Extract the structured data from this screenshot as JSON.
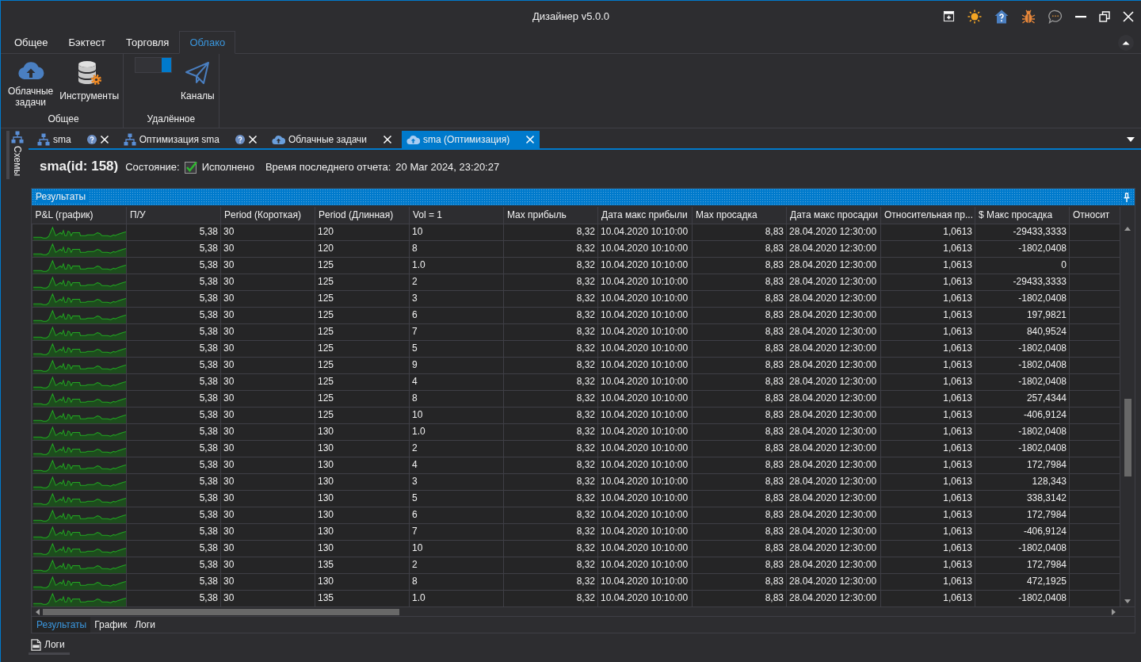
{
  "window": {
    "title": "Дизайнер v5.0.0"
  },
  "ribbon": {
    "tabs": [
      {
        "label": "Общее",
        "selected": false
      },
      {
        "label": "Бэктест",
        "selected": false
      },
      {
        "label": "Торговля",
        "selected": false
      },
      {
        "label": "Облако",
        "selected": true
      }
    ],
    "groups": [
      {
        "label": "Общее",
        "items": [
          {
            "kind": "button",
            "label": "Облачные задачи"
          },
          {
            "kind": "button",
            "label": "Инструменты"
          }
        ]
      },
      {
        "label": "Удалённое",
        "items": [
          {
            "kind": "toggle",
            "on": true
          },
          {
            "kind": "button",
            "label": "Каналы"
          }
        ]
      }
    ]
  },
  "side_panel": {
    "label": "Схемы"
  },
  "document_tabs": [
    {
      "kind": "scheme",
      "label": "sma",
      "selected": false
    },
    {
      "kind": "scheme",
      "label": "Оптимизация sma",
      "selected": false
    },
    {
      "kind": "cloud",
      "label": "Облачные задачи",
      "selected": false
    },
    {
      "kind": "cloud",
      "label": "sma (Оптимизация)",
      "selected": true
    }
  ],
  "document": {
    "title": "sma(id: 158)",
    "status_label": "Состояние:",
    "status": {
      "checked": true,
      "label": "Исполнено"
    },
    "report_label": "Время последнего отчета:",
    "report_time": "20 Mar 2024, 23:20:27"
  },
  "results": {
    "title": "Результаты",
    "table": {
      "columns": [
        {
          "label": "P&L (график)",
          "kind": "sparkline"
        },
        {
          "label": "П/У",
          "kind": "number"
        },
        {
          "label": "Period (Короткая)",
          "kind": "text"
        },
        {
          "label": "Period (Длинная)",
          "kind": "text"
        },
        {
          "label": "Vol = 1",
          "kind": "text"
        },
        {
          "label": "Max прибыль",
          "kind": "number"
        },
        {
          "label": "Дата макс прибыли",
          "kind": "text"
        },
        {
          "label": "Max просадка",
          "kind": "number"
        },
        {
          "label": "Дата макс просадки",
          "kind": "text"
        },
        {
          "label": "Относительная пр...",
          "kind": "number"
        },
        {
          "label": "$ Макс просадка",
          "kind": "number"
        },
        {
          "label": "Относит",
          "kind": "number"
        }
      ],
      "rows": [
        {
          "cells": [
            "",
            "5,38",
            "30",
            "120",
            "10",
            "8,32",
            "10.04.2020 10:10:00",
            "8,83",
            "28.04.2020 12:30:00",
            "1,0613",
            "-29433,3333"
          ]
        },
        {
          "cells": [
            "",
            "5,38",
            "30",
            "120",
            "8",
            "8,32",
            "10.04.2020 10:10:00",
            "8,83",
            "28.04.2020 12:30:00",
            "1,0613",
            "-1802,0408"
          ]
        },
        {
          "cells": [
            "",
            "5,38",
            "30",
            "125",
            "1.0",
            "8,32",
            "10.04.2020 10:10:00",
            "8,83",
            "28.04.2020 12:30:00",
            "1,0613",
            "0"
          ]
        },
        {
          "cells": [
            "",
            "5,38",
            "30",
            "125",
            "2",
            "8,32",
            "10.04.2020 10:10:00",
            "8,83",
            "28.04.2020 12:30:00",
            "1,0613",
            "-29433,3333"
          ]
        },
        {
          "cells": [
            "",
            "5,38",
            "30",
            "125",
            "3",
            "8,32",
            "10.04.2020 10:10:00",
            "8,83",
            "28.04.2020 12:30:00",
            "1,0613",
            "-1802,0408"
          ]
        },
        {
          "cells": [
            "",
            "5,38",
            "30",
            "125",
            "6",
            "8,32",
            "10.04.2020 10:10:00",
            "8,83",
            "28.04.2020 12:30:00",
            "1,0613",
            "197,9821"
          ]
        },
        {
          "cells": [
            "",
            "5,38",
            "30",
            "125",
            "7",
            "8,32",
            "10.04.2020 10:10:00",
            "8,83",
            "28.04.2020 12:30:00",
            "1,0613",
            "840,9524"
          ]
        },
        {
          "cells": [
            "",
            "5,38",
            "30",
            "125",
            "5",
            "8,32",
            "10.04.2020 10:10:00",
            "8,83",
            "28.04.2020 12:30:00",
            "1,0613",
            "-1802,0408"
          ]
        },
        {
          "cells": [
            "",
            "5,38",
            "30",
            "125",
            "9",
            "8,32",
            "10.04.2020 10:10:00",
            "8,83",
            "28.04.2020 12:30:00",
            "1,0613",
            "-1802,0408"
          ]
        },
        {
          "cells": [
            "",
            "5,38",
            "30",
            "125",
            "4",
            "8,32",
            "10.04.2020 10:10:00",
            "8,83",
            "28.04.2020 12:30:00",
            "1,0613",
            "-1802,0408"
          ]
        },
        {
          "cells": [
            "",
            "5,38",
            "30",
            "125",
            "8",
            "8,32",
            "10.04.2020 10:10:00",
            "8,83",
            "28.04.2020 12:30:00",
            "1,0613",
            "257,4344"
          ]
        },
        {
          "cells": [
            "",
            "5,38",
            "30",
            "125",
            "10",
            "8,32",
            "10.04.2020 10:10:00",
            "8,83",
            "28.04.2020 12:30:00",
            "1,0613",
            "-406,9124"
          ]
        },
        {
          "cells": [
            "",
            "5,38",
            "30",
            "130",
            "1.0",
            "8,32",
            "10.04.2020 10:10:00",
            "8,83",
            "28.04.2020 12:30:00",
            "1,0613",
            "-1802,0408"
          ]
        },
        {
          "cells": [
            "",
            "5,38",
            "30",
            "130",
            "2",
            "8,32",
            "10.04.2020 10:10:00",
            "8,83",
            "28.04.2020 12:30:00",
            "1,0613",
            "-1802,0408"
          ]
        },
        {
          "cells": [
            "",
            "5,38",
            "30",
            "130",
            "4",
            "8,32",
            "10.04.2020 10:10:00",
            "8,83",
            "28.04.2020 12:30:00",
            "1,0613",
            "172,7984"
          ]
        },
        {
          "cells": [
            "",
            "5,38",
            "30",
            "130",
            "3",
            "8,32",
            "10.04.2020 10:10:00",
            "8,83",
            "28.04.2020 12:30:00",
            "1,0613",
            "128,343"
          ]
        },
        {
          "cells": [
            "",
            "5,38",
            "30",
            "130",
            "5",
            "8,32",
            "10.04.2020 10:10:00",
            "8,83",
            "28.04.2020 12:30:00",
            "1,0613",
            "338,3142"
          ]
        },
        {
          "cells": [
            "",
            "5,38",
            "30",
            "130",
            "6",
            "8,32",
            "10.04.2020 10:10:00",
            "8,83",
            "28.04.2020 12:30:00",
            "1,0613",
            "172,7984"
          ]
        },
        {
          "cells": [
            "",
            "5,38",
            "30",
            "130",
            "7",
            "8,32",
            "10.04.2020 10:10:00",
            "8,83",
            "28.04.2020 12:30:00",
            "1,0613",
            "-406,9124"
          ]
        },
        {
          "cells": [
            "",
            "5,38",
            "30",
            "130",
            "10",
            "8,32",
            "10.04.2020 10:10:00",
            "8,83",
            "28.04.2020 12:30:00",
            "1,0613",
            "-1802,0408"
          ]
        },
        {
          "cells": [
            "",
            "5,38",
            "30",
            "135",
            "2",
            "8,32",
            "10.04.2020 10:10:00",
            "8,83",
            "28.04.2020 12:30:00",
            "1,0613",
            "172,7984"
          ]
        },
        {
          "cells": [
            "",
            "5,38",
            "30",
            "130",
            "8",
            "8,32",
            "10.04.2020 10:10:00",
            "8,83",
            "28.04.2020 12:30:00",
            "1,0613",
            "472,1925"
          ]
        },
        {
          "cells": [
            "",
            "5,38",
            "30",
            "135",
            "1.0",
            "8,32",
            "10.04.2020 10:10:00",
            "8,83",
            "28.04.2020 12:30:00",
            "1,0613",
            "-1802,0408"
          ]
        }
      ]
    },
    "tabs": [
      {
        "label": "Результаты",
        "selected": true
      },
      {
        "label": "График",
        "selected": false
      },
      {
        "label": "Логи",
        "selected": false
      }
    ]
  },
  "dock": {
    "label": "Логи"
  }
}
